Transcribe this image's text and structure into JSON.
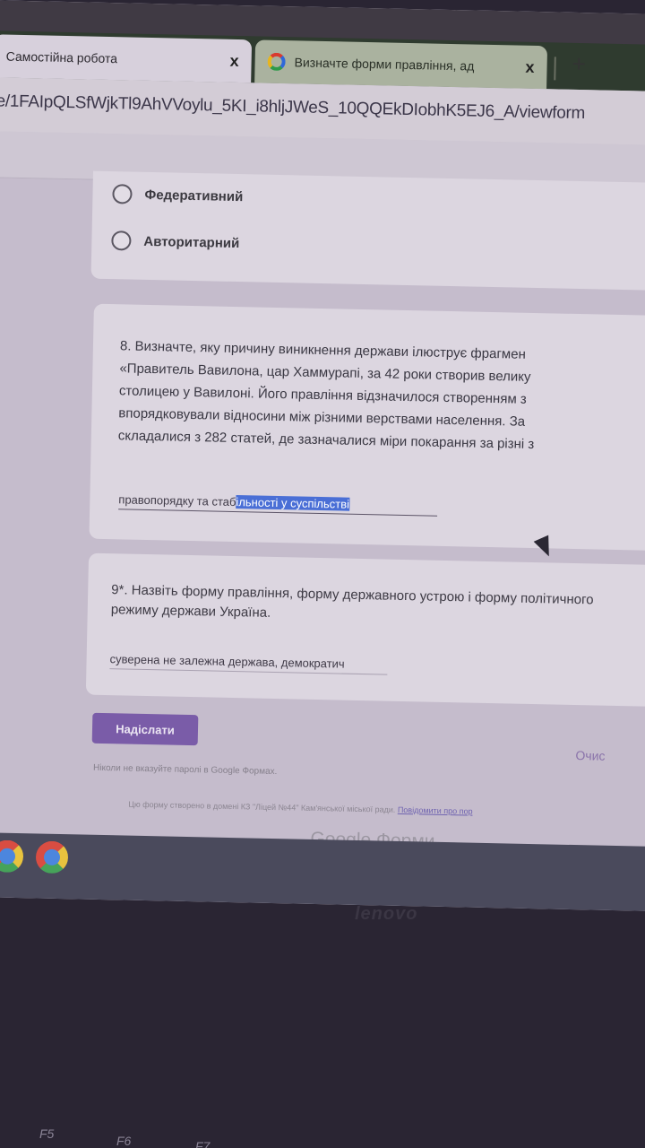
{
  "browser": {
    "tabs": [
      {
        "label": "Самостійна робота",
        "active": true
      },
      {
        "label": "Визначте форми правління, ад",
        "active": false
      }
    ],
    "close_glyph": "x",
    "new_tab_glyph": "+",
    "url": "e/1FAIpQLSfWjkTl9AhVVoylu_5KI_i8hljJWeS_10QQEkDIobhK5EJ6_A/viewform"
  },
  "form": {
    "options": [
      "Федеративний",
      "Авторитарний"
    ],
    "q8": {
      "lines": [
        "8. Визначте, яку причину виникнення держави ілюструє фрагмен",
        "«Правитель Вавилона, цар Хаммурапі, за 42 роки створив велику",
        "столицею у Вавилоні. Його правління відзначилося створенням з",
        "впорядковували відносини між різними верствами населення. За",
        "складалися з 282 статей, де зазначалися міри покарання за різні з"
      ],
      "answer_plain": "правопорядку та стаб",
      "answer_selected": "ільності у суспільстві"
    },
    "q9": {
      "text": "9*. Назвіть форму правління, форму державного устрою і форму політичного режиму держави Україна.",
      "answer": "суверена не залежна держава, демократич"
    },
    "submit_label": "Надіслати",
    "clear_label": "Очис",
    "password_note": "Ніколи не вказуйте паролі в Google Формах.",
    "domain_note": "Цю форму створено в домені КЗ \"Ліцей №44\" Кам'янської міської ради.",
    "report_link": "Повідомити про пор",
    "brand": "Google Форми"
  },
  "icons": [
    "google-icon",
    "chrome-icon",
    "cursor-icon"
  ],
  "laptop": {
    "brand": "lenovo",
    "keys": [
      "F5",
      "F6",
      "F7"
    ]
  }
}
